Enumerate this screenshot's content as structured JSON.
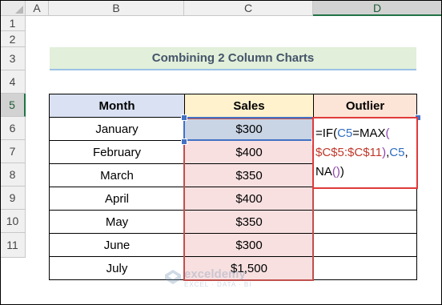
{
  "column_headers": [
    "A",
    "B",
    "C",
    "D"
  ],
  "row_headers": [
    "1",
    "2",
    "3",
    "4",
    "5",
    "6",
    "7",
    "8",
    "9",
    "10",
    "11"
  ],
  "selected_column": "D",
  "selected_row": "5",
  "title": "Combining 2 Column Charts",
  "table": {
    "headers": [
      "Month",
      "Sales",
      "Outlier"
    ],
    "rows": [
      {
        "month": "January",
        "sales": "$300"
      },
      {
        "month": "February",
        "sales": "$400"
      },
      {
        "month": "March",
        "sales": "$350"
      },
      {
        "month": "April",
        "sales": "$400"
      },
      {
        "month": "May",
        "sales": "$350"
      },
      {
        "month": "June",
        "sales": "$300"
      },
      {
        "month": "July",
        "sales": "$1,500"
      }
    ]
  },
  "formula_tokens": [
    {
      "text": "=IF(",
      "kind": "black"
    },
    {
      "text": "C5",
      "kind": "blue"
    },
    {
      "text": "=MAX",
      "kind": "black"
    },
    {
      "text": "(",
      "kind": "purple"
    },
    {
      "text": "\n$C$5:$C$11",
      "kind": "red"
    },
    {
      "text": ")",
      "kind": "purple"
    },
    {
      "text": ",",
      "kind": "black"
    },
    {
      "text": "C5",
      "kind": "blue"
    },
    {
      "text": ",\nNA",
      "kind": "black"
    },
    {
      "text": "()",
      "kind": "purple"
    },
    {
      "text": ")",
      "kind": "black"
    }
  ],
  "watermark": {
    "brand": "exceldemy",
    "tagline": "EXCEL · DATA · BI"
  },
  "colors": {
    "month_header_bg": "#d9e1f2",
    "sales_header_bg": "#fff2cc",
    "outlier_header_bg": "#fce4d6",
    "sales_cell_bg": "#f8e0e0",
    "active_cell_bg": "#c9d4e4",
    "title_bg": "#e2efda",
    "range_border": "#c0504d",
    "active_border": "#4472c4"
  }
}
